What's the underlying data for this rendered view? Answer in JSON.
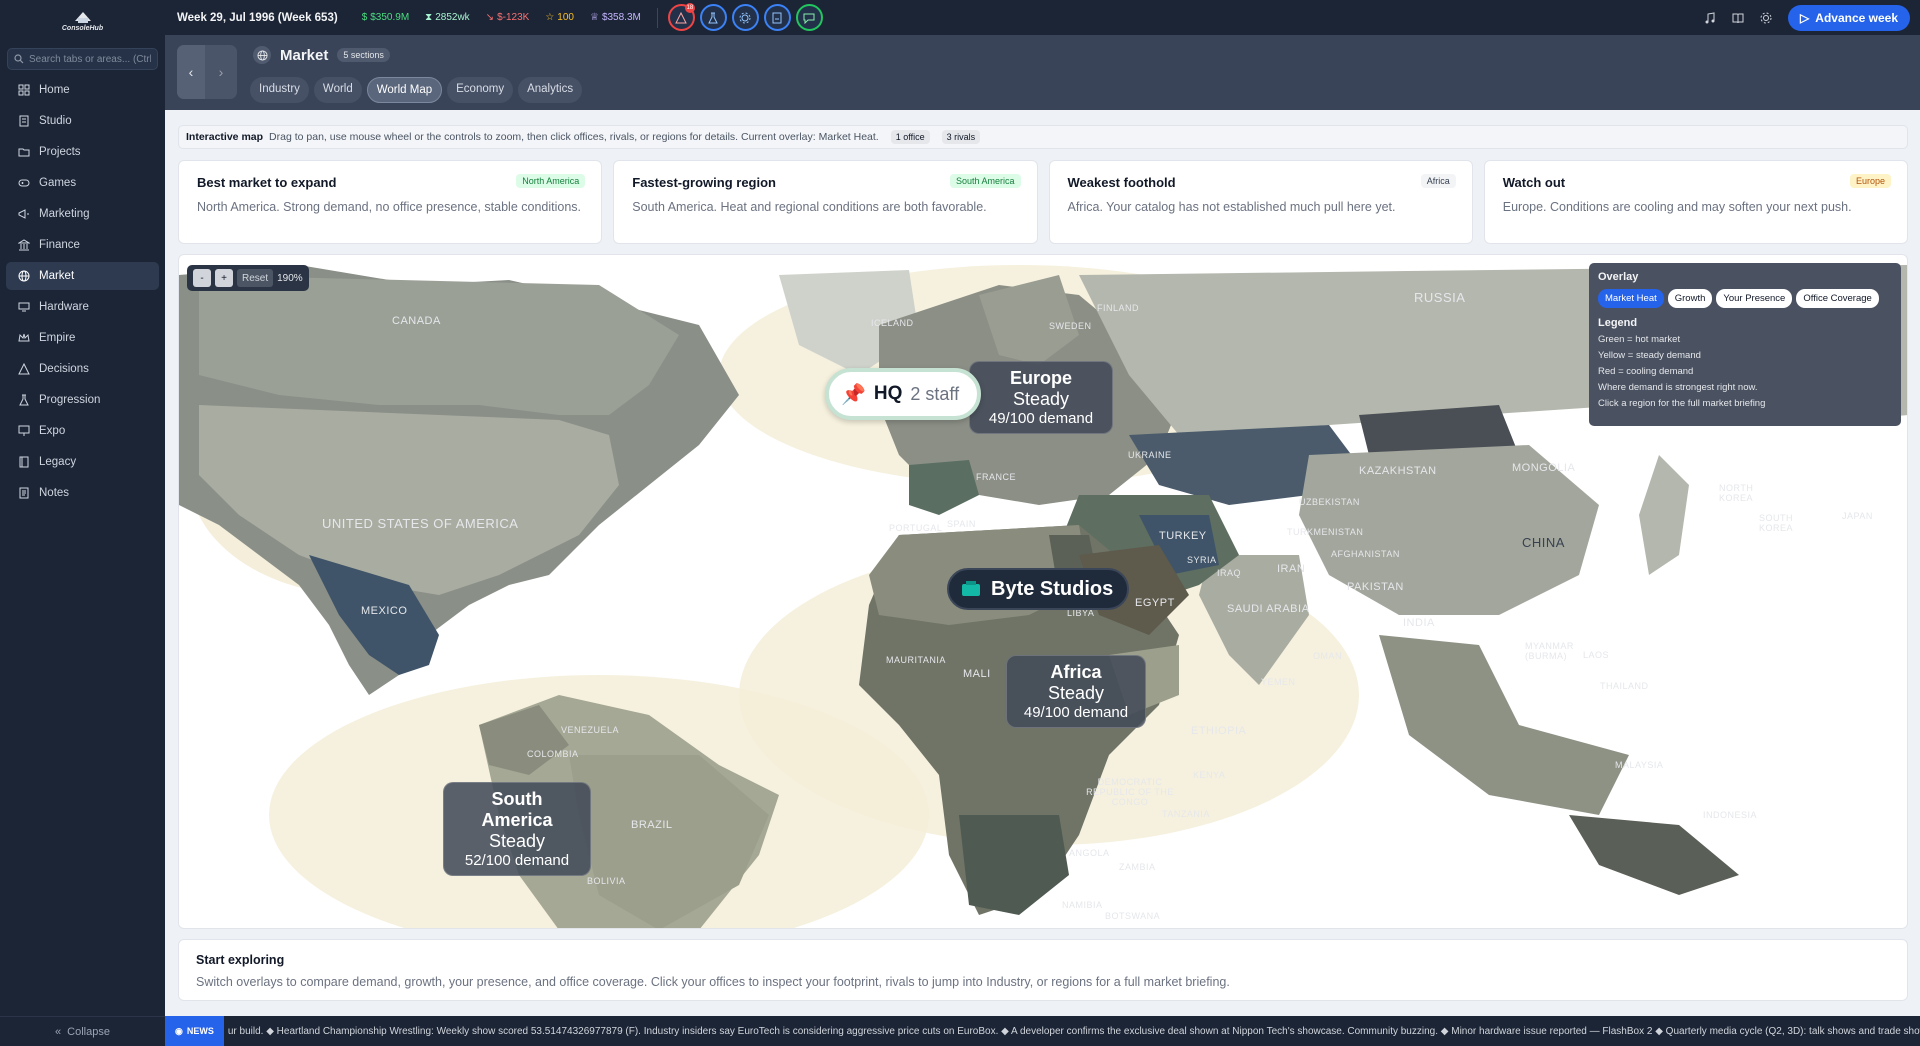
{
  "app": {
    "logo_text": "ConsoleHub"
  },
  "sidebar": {
    "search_placeholder": "Search tabs or areas... (Ctrl+K)",
    "items": [
      {
        "label": "Home"
      },
      {
        "label": "Studio"
      },
      {
        "label": "Projects"
      },
      {
        "label": "Games"
      },
      {
        "label": "Marketing"
      },
      {
        "label": "Finance"
      },
      {
        "label": "Market"
      },
      {
        "label": "Hardware"
      },
      {
        "label": "Empire"
      },
      {
        "label": "Decisions"
      },
      {
        "label": "Progression"
      },
      {
        "label": "Expo"
      },
      {
        "label": "Legacy"
      },
      {
        "label": "Notes"
      }
    ],
    "collapse_label": "Collapse"
  },
  "topbar": {
    "week": "Week 29, Jul 1996 (Week 653)",
    "cash": "$350.9M",
    "fans": "2852wk",
    "burn": "$-123K",
    "reputation": "100",
    "valuation": "$358.3M",
    "alert_count": "18",
    "advance_label": "Advance week"
  },
  "header": {
    "title": "Market",
    "sections_badge": "5 sections",
    "tabs": [
      {
        "label": "Industry"
      },
      {
        "label": "World"
      },
      {
        "label": "World Map"
      },
      {
        "label": "Economy"
      },
      {
        "label": "Analytics"
      }
    ]
  },
  "info": {
    "title": "Interactive map",
    "desc": "Drag to pan, use mouse wheel or the controls to zoom, then click offices, rivals, or regions for details. Current overlay: Market Heat.",
    "offices": "1 office",
    "rivals": "3 rivals"
  },
  "cards": [
    {
      "title": "Best market to expand",
      "tag": "North America",
      "body": "North America. Strong demand, no office presence, stable conditions."
    },
    {
      "title": "Fastest-growing region",
      "tag": "South America",
      "body": "South America. Heat and regional conditions are both favorable."
    },
    {
      "title": "Weakest foothold",
      "tag": "Africa",
      "body": "Africa. Your catalog has not established much pull here yet."
    },
    {
      "title": "Watch out",
      "tag": "Europe",
      "body": "Europe. Conditions are cooling and may soften your next push."
    }
  ],
  "map": {
    "zoom_minus": "-",
    "zoom_plus": "+",
    "reset_label": "Reset",
    "zoom_level": "190%",
    "countries": {
      "canada": "CANADA",
      "russia": "RUSSIA",
      "usa": "UNITED STATES OF AMERICA",
      "mexico": "MEXICO",
      "kazakhstan": "KAZAKHSTAN",
      "mongolia": "MONGOLIA",
      "china": "CHINA",
      "turkey": "TURKEY",
      "iran": "IRAN",
      "pakistan": "PAKISTAN",
      "india": "INDIA",
      "egypt": "EGYPT",
      "saudi": "SAUDI ARABIA",
      "mali": "MALI",
      "mauritania": "MAURITANIA",
      "libya": "LIBYA",
      "ethiopia": "ETHIOPIA",
      "kenya": "KENYA",
      "tanzania": "TANZANIA",
      "drc": "DEMOCRATIC REPUBLIC OF THE CONGO",
      "angola": "ANGOLA",
      "zambia": "ZAMBIA",
      "namibia": "NAMIBIA",
      "botswana": "BOTSWANA",
      "venezuela": "VENEZUELA",
      "colombia": "COLOMBIA",
      "brazil": "BRAZIL",
      "bolivia": "BOLIVIA",
      "spain": "SPAIN",
      "france": "FRANCE",
      "ukraine": "UKRAINE",
      "sweden": "SWEDEN",
      "finland": "FINLAND",
      "iceland": "ICELAND",
      "iraq": "IRAQ",
      "syria": "SYRIA",
      "afghanistan": "AFGHANISTAN",
      "uzbekistan": "UZBEKISTAN",
      "turkmenistan": "TURKMENISTAN",
      "thailand": "THAILAND",
      "indonesia": "INDONESIA",
      "japan": "JAPAN",
      "yemen": "YEMEN",
      "myanmar": "MYANMAR (BURMA)",
      "portugal": "PORTUGAL",
      "north_korea": "NORTH KOREA",
      "south_korea": "SOUTH KOREA",
      "malaysia": "MALAYSIA",
      "laos": "LAOS",
      "oman": "OMAN"
    },
    "regions": [
      {
        "name": "Europe",
        "state": "Steady",
        "demand": "49/100 demand"
      },
      {
        "name": "Africa",
        "state": "Steady",
        "demand": "49/100 demand"
      },
      {
        "name": "South America",
        "state": "Steady",
        "demand": "52/100 demand"
      }
    ],
    "hq": {
      "title": "HQ",
      "staff": "2 staff"
    },
    "rival": {
      "name": "Byte Studios"
    },
    "overlay": {
      "title": "Overlay",
      "buttons": [
        {
          "label": "Market Heat"
        },
        {
          "label": "Growth"
        },
        {
          "label": "Your Presence"
        },
        {
          "label": "Office Coverage"
        }
      ],
      "legend_title": "Legend",
      "legend": [
        "Green = hot market",
        "Yellow = steady demand",
        "Red = cooling demand",
        "Where demand is strongest right now.",
        "Click a region for the full market briefing"
      ]
    }
  },
  "explore": {
    "title": "Start exploring",
    "body": "Switch overlays to compare demand, growth, your presence, and office coverage. Click your offices to inspect your footprint, rivals to jump into Industry, or regions for a full market briefing."
  },
  "news": {
    "badge": "NEWS",
    "text": "ur build. ◆ Heartland Championship Wrestling: Weekly show scored 53.51474326977879 (F).          Industry insiders say EuroTech is considering aggressive price cuts on EuroBox. ◆ A developer confirms the exclusive deal shown at Nippon Tech's showcase. Community buzzing. ◆ Minor hardware issue reported — FlashBox 2 ◆ Quarterly media cycle (Q2, 3D): talk shows and trade shows"
  },
  "colors": {
    "accent": "#2563eb",
    "sidebar_bg": "#1c2536",
    "header_bg": "#3a4459"
  }
}
